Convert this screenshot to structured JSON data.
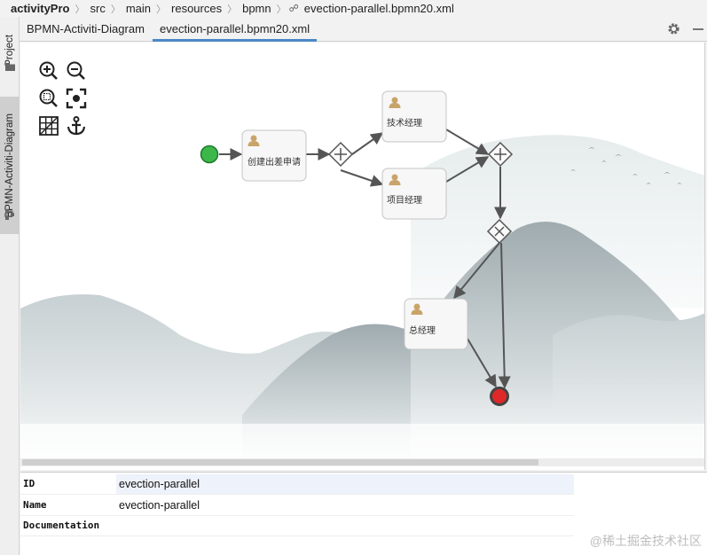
{
  "breadcrumb": {
    "project": "activityPro",
    "items": [
      "src",
      "main",
      "resources",
      "bpmn"
    ],
    "file": "evection-parallel.bpmn20.xml"
  },
  "sidebar": {
    "tabs": [
      {
        "label": "Project",
        "icon": "folder-icon"
      },
      {
        "label": "BPMN-Activiti-Diagram",
        "icon": "diagram-icon"
      }
    ]
  },
  "tabs": [
    {
      "label": "BPMN-Activiti-Diagram",
      "active": false
    },
    {
      "label": "evection-parallel.bpmn20.xml",
      "active": true
    }
  ],
  "toolbar": {
    "buttons": [
      "zoom-in-icon",
      "zoom-out-icon",
      "zoom-fit-icon",
      "focus-center-icon",
      "grid-icon",
      "anchor-icon"
    ]
  },
  "diagram": {
    "tasks": {
      "create": "创建出差申请",
      "tech": "技术经理",
      "project": "项目经理",
      "gm": "总经理"
    },
    "colors": {
      "start": "#3cb84a",
      "end": "#e02828",
      "task_fill": "#f7f7f7",
      "task_border": "#c4c4c4",
      "flow": "#555555",
      "user_icon": "#c9a46a"
    }
  },
  "properties": {
    "rows": [
      {
        "key": "ID",
        "value": "evection-parallel"
      },
      {
        "key": "Name",
        "value": "evection-parallel"
      },
      {
        "key": "Documentation",
        "value": ""
      }
    ]
  },
  "watermark": "@稀土掘金技术社区",
  "accent": "#4a88c7"
}
